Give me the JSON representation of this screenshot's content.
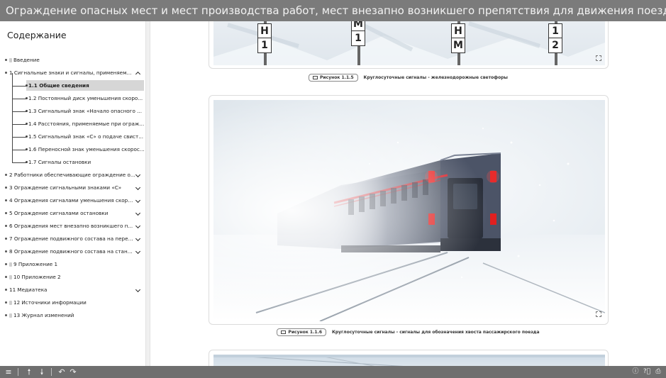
{
  "window": {
    "title": "Ограждение опасных мест и мест производства работ, мест внезапно возникшего препятствия для движения поездов"
  },
  "sidebar": {
    "title": "Содержание",
    "items": [
      {
        "label": "Введение",
        "has_doc_icon": true,
        "expandable": false
      },
      {
        "label": "1 Сигнальные знаки и сигналы, применяем...",
        "expandable": true,
        "expanded": true
      },
      {
        "label": "2 Работники обеспечивающие ограждение о...",
        "expandable": true
      },
      {
        "label": "3 Ограждение сигнальными знаками «С»",
        "expandable": true
      },
      {
        "label": "4 Ограждения сигналами уменьшения скоро...",
        "expandable": true
      },
      {
        "label": "5 Ограждение сигналами остановки",
        "expandable": true
      },
      {
        "label": "6 Ограждения мест внезапно возникшего п...",
        "expandable": true
      },
      {
        "label": "7 Ограждение подвижного состава на перег...",
        "expandable": true
      },
      {
        "label": "8 Ограждение подвижного состава на станц...",
        "expandable": true
      },
      {
        "label": "9 Приложение 1",
        "expandable": false
      },
      {
        "label": "10 Приложение 2",
        "expandable": false
      },
      {
        "label": "11 Медиатека",
        "expandable": true
      },
      {
        "label": "12 Источники информации",
        "expandable": false
      },
      {
        "label": "13 Журнал изменений",
        "expandable": false
      }
    ],
    "subitems": [
      {
        "label": "1.1 Общие сведения",
        "active": true
      },
      {
        "label": "1.2 Постоянный диск уменьшения скоро..."
      },
      {
        "label": "1.3 Сигнальный знак «Начало опасного ..."
      },
      {
        "label": "1.4 Расстояния, применяемые при ограж..."
      },
      {
        "label": "1.5 Сигнальный знак «С» о подаче свист..."
      },
      {
        "label": "1.6 Переносной знак уменьшения скорос..."
      },
      {
        "label": "1.7 Сигналы остановки"
      }
    ]
  },
  "figures": [
    {
      "badge": "Рисунок 1.1.5",
      "caption": "Круглосуточные сигналы - железнодорожные светофоры",
      "signs": [
        {
          "letters": [
            "Н",
            "1"
          ]
        },
        {
          "letters": [
            "М",
            "1"
          ]
        },
        {
          "letters": [
            "Н",
            "М"
          ]
        },
        {
          "letters": [
            "1",
            "2"
          ]
        }
      ]
    },
    {
      "badge": "Рисунок 1.1.6",
      "caption": "Круглосуточные сигналы - сигналы для обозначения хвоста пассажирского поезда"
    }
  ],
  "colors": {
    "titlebar": "#7b7b7b",
    "bottombar": "#6f6f6f",
    "active_item": "#d6d6d6",
    "train_body": "#5b6476",
    "train_stripe": "#d9272e",
    "tail_light": "#e02020"
  },
  "toolbar": {
    "left_icons": [
      "menu-icon",
      "arrow-up-icon",
      "arrow-down-icon",
      "undo-icon",
      "redo-icon"
    ],
    "right_icons": [
      "info-icon",
      "help-icon",
      "print-icon"
    ]
  }
}
